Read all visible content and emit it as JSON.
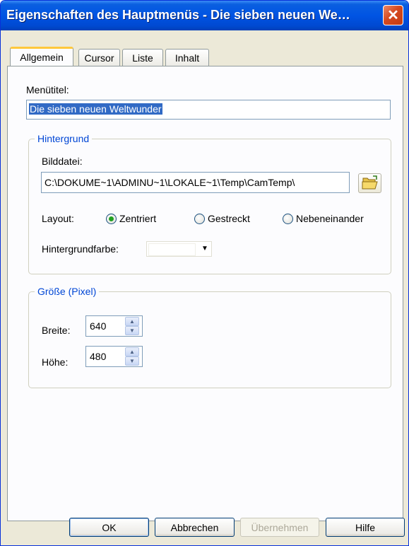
{
  "window": {
    "title": "Eigenschaften des Hauptmenüs - Die sieben neuen We…",
    "close_glyph": "✕"
  },
  "tabs": [
    {
      "label": "Allgemein",
      "active": true
    },
    {
      "label": "Cursor",
      "active": false
    },
    {
      "label": "Liste",
      "active": false
    },
    {
      "label": "Inhalt",
      "active": false
    }
  ],
  "menu_title": {
    "label": "Menütitel:",
    "value": "Die sieben neuen Weltwunder"
  },
  "background": {
    "legend": "Hintergrund",
    "image_file_label": "Bilddatei:",
    "image_file_value": "C:\\DOKUME~1\\ADMINU~1\\LOKALE~1\\Temp\\CamTemp\\",
    "browse_icon": "folder-open-icon",
    "layout_label": "Layout:",
    "layout_options": [
      {
        "label": "Zentriert",
        "selected": true
      },
      {
        "label": "Gestreckt",
        "selected": false
      },
      {
        "label": "Nebeneinander",
        "selected": false
      }
    ],
    "color_label": "Hintergrundfarbe:",
    "color_value": "#ffffff"
  },
  "size": {
    "legend": "Größe (Pixel)",
    "width_label": "Breite:",
    "width_value": "640",
    "height_label": "Höhe:",
    "height_value": "480"
  },
  "buttons": {
    "ok": "OK",
    "cancel": "Abbrechen",
    "apply": "Übernehmen",
    "help": "Hilfe"
  },
  "colors": {
    "titlebar": "#0054e3",
    "selection": "#316ac5",
    "group_legend": "#0046d5",
    "radio_dot": "#21a121"
  }
}
